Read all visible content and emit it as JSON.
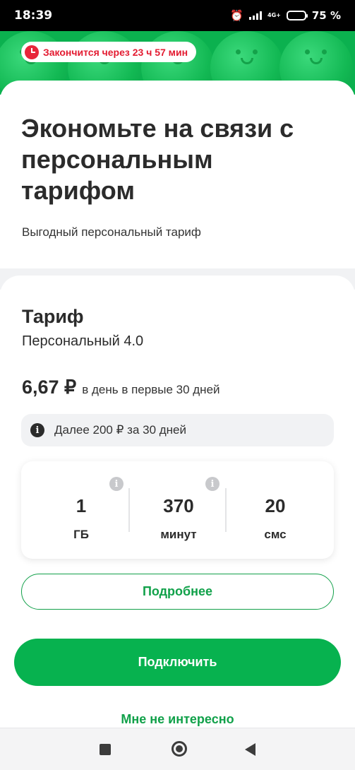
{
  "status_bar": {
    "time": "18:39",
    "network": "4G+",
    "battery": "75 %",
    "battery_level": 0.75
  },
  "promo": {
    "timer_text": "Закончится через 23 ч 57 мин",
    "timer_color": "#e31b31"
  },
  "offer": {
    "headline": "Экономьте на связи с персональным тарифом",
    "subtitle": "Выгодный персональный тариф"
  },
  "tariff": {
    "section_title": "Тариф",
    "name": "Персональный 4.0",
    "price": "6,67 ₽",
    "price_note": "в день в первые 30 дней",
    "after_note": "Далее 200 ₽ за 30 дней"
  },
  "package": [
    {
      "value": "1",
      "unit": "ГБ"
    },
    {
      "value": "370",
      "unit": "минут"
    },
    {
      "value": "20",
      "unit": "смс"
    }
  ],
  "actions": {
    "details_label": "Подробнее",
    "connect_label": "Подключить",
    "decline_label": "Мне не интересно"
  },
  "colors": {
    "brand_green": "#07b24f",
    "alert_red": "#e31b31"
  }
}
